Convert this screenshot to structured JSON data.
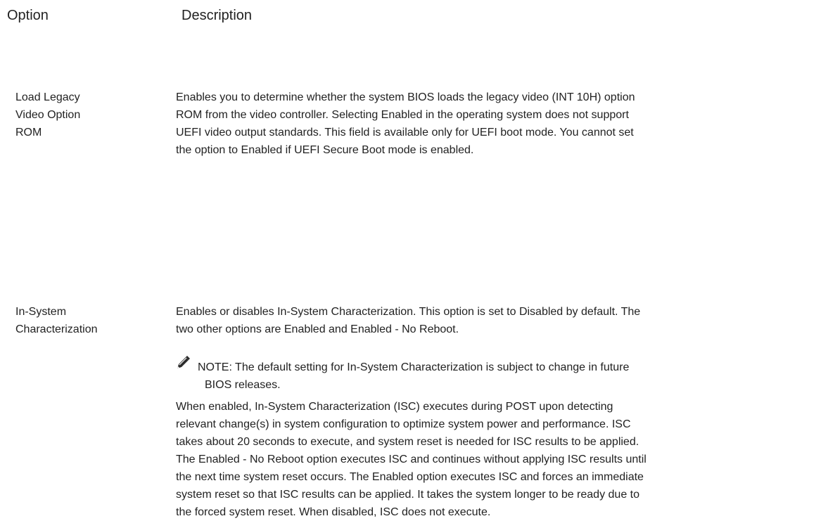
{
  "header": {
    "option": "Option",
    "description": "Description"
  },
  "rows": [
    {
      "name_lines": [
        "Load Legacy",
        "Video Option",
        "ROM"
      ],
      "desc_lines": [
        "Enables you to determine whether the system BIOS loads the legacy video (INT 10H) option",
        "ROM from the video controller. Selecting Enabled in the operating system does not support",
        "UEFI video output standards. This field is available only for UEFI boot mode. You cannot set",
        "the option to Enabled if UEFI Secure Boot mode is enabled."
      ]
    },
    {
      "name_lines": [
        "In-System",
        "Characterization"
      ],
      "desc_lines": [
        "Enables or disables In-System Characterization. This option is set to Disabled by default. The",
        "two other options are Enabled and Enabled - No Reboot."
      ],
      "note_icon": "pencil-note-icon",
      "note_lines": [
        "NOTE: The default setting for In-System Characterization is subject to change in future",
        "BIOS releases."
      ],
      "detail_lines": [
        "When enabled, In-System Characterization (ISC) executes during POST upon detecting",
        "relevant change(s) in system configuration to optimize system power and performance. ISC",
        "takes about 20 seconds to execute, and system reset is needed for ISC results to be applied.",
        "The Enabled - No Reboot option executes ISC and continues without applying ISC results until",
        "the next time system reset occurs. The Enabled option executes ISC and forces an immediate",
        "system reset so that ISC results can be applied. It takes the system longer to be ready due to",
        "the forced system reset. When disabled, ISC does not execute."
      ]
    }
  ]
}
